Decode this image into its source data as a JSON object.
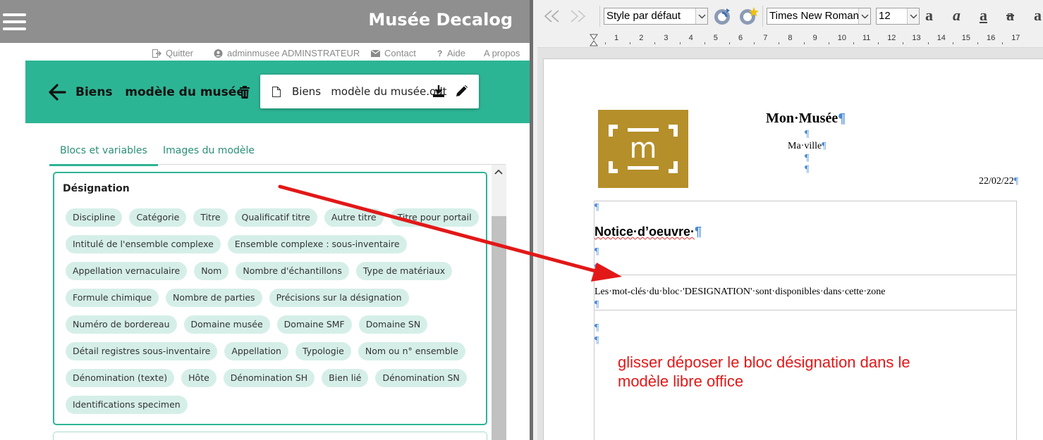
{
  "app": {
    "title": "Musée Decalog",
    "top_links": {
      "quit": "Quitter",
      "user": "adminmusee ADMINSTRATEUR",
      "contact": "Contact",
      "help": "Aide",
      "about": "A propos"
    }
  },
  "header": {
    "title": "Biens   modèle du musée",
    "file_name": "Biens   modèle du musée.odt"
  },
  "tabs": {
    "blocks": "Blocs et variables",
    "images": "Images du modèle"
  },
  "block": {
    "title": "Désignation",
    "rows": [
      [
        "Discipline",
        "Catégorie",
        "Titre",
        "Qualificatif titre",
        "Autre titre",
        "Titre pour portail"
      ],
      [
        "Intitulé de l'ensemble complexe",
        "Ensemble complexe : sous-inventaire"
      ],
      [
        "Appellation vernaculaire",
        "Nom",
        "Nombre d'échantillons",
        "Type de matériaux"
      ],
      [
        "Formule chimique",
        "Nombre de parties",
        "Précisions sur la désignation"
      ],
      [
        "Numéro de bordereau",
        "Domaine musée",
        "Domaine SMF",
        "Domaine SN"
      ],
      [
        "Détail registres sous-inventaire",
        "Appellation",
        "Typologie",
        "Nom ou n° ensemble"
      ],
      [
        "Dénomination (texte)",
        "Hôte",
        "Dénomination SH",
        "Bien lié",
        "Dénomination SN"
      ],
      [
        "Identifications specimen"
      ]
    ]
  },
  "writer": {
    "style_select": "Style par défaut",
    "font_select": "Times New Roman",
    "size_select": "12",
    "ruler_numbers": [
      "1",
      "2",
      "3",
      "4",
      "5",
      "6",
      "7",
      "8",
      "9",
      "10",
      "11",
      "12",
      "13",
      "14",
      "15",
      "16",
      "17"
    ],
    "logo_letter": "m",
    "museum_name": "Mon·Musée",
    "city": "Ma·ville",
    "date": "22/02/22",
    "notice_title": "Notice·d’oeuvre·",
    "zone_text": "Les·mot-clés·du·bloc·'DESIGNATION'·sont·disponibles·dans·cette·zone",
    "pilcrow": "¶",
    "annotation_line1": "glisser déposer le bloc désignation dans le",
    "annotation_line2": "modèle libre office"
  },
  "colors": {
    "topbar": "#8f8f8f",
    "accent": "#2cb594",
    "chip": "#d5efe8",
    "logo": "#b58f2a",
    "arrow": "#e21818"
  }
}
